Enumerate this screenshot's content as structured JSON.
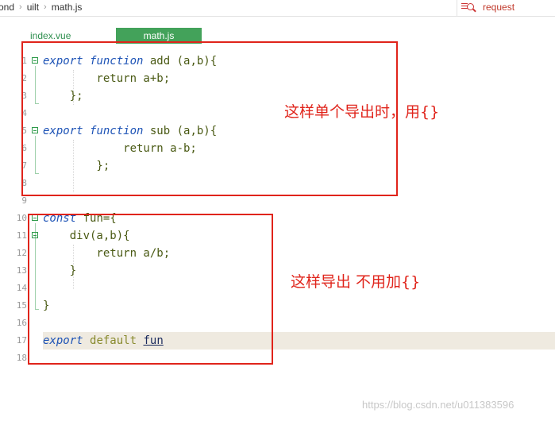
{
  "breadcrumb": [
    "ond",
    "uilt",
    "math.js"
  ],
  "search": {
    "query": "request"
  },
  "tabs": [
    {
      "label": "index.vue",
      "active": false
    },
    {
      "label": "math.js",
      "active": true
    }
  ],
  "code_lines": [
    {
      "num": "1",
      "parts": [
        [
          "kw",
          "export"
        ],
        [
          "sp",
          " "
        ],
        [
          "kw",
          "function"
        ],
        [
          "txt",
          " add (a,b){"
        ]
      ]
    },
    {
      "num": "2",
      "parts": [
        [
          "txt",
          "        return a+b;"
        ]
      ]
    },
    {
      "num": "3",
      "parts": [
        [
          "txt",
          "    };"
        ]
      ]
    },
    {
      "num": "4",
      "parts": []
    },
    {
      "num": "5",
      "parts": [
        [
          "kw",
          "export"
        ],
        [
          "sp",
          " "
        ],
        [
          "kw",
          "function"
        ],
        [
          "txt",
          " sub (a,b){"
        ]
      ]
    },
    {
      "num": "6",
      "parts": [
        [
          "txt",
          "            return a-b;"
        ]
      ]
    },
    {
      "num": "7",
      "parts": [
        [
          "txt",
          "        };"
        ]
      ]
    },
    {
      "num": "8",
      "parts": []
    },
    {
      "num": "9",
      "parts": []
    },
    {
      "num": "10",
      "parts": [
        [
          "kw",
          "const"
        ],
        [
          "txt",
          " fun={"
        ]
      ]
    },
    {
      "num": "11",
      "parts": [
        [
          "txt",
          "    div(a,b){"
        ]
      ]
    },
    {
      "num": "12",
      "parts": [
        [
          "txt",
          "        return a/b;"
        ]
      ]
    },
    {
      "num": "13",
      "parts": [
        [
          "txt",
          "    }"
        ]
      ]
    },
    {
      "num": "14",
      "parts": []
    },
    {
      "num": "15",
      "parts": [
        [
          "txt",
          "}"
        ]
      ]
    },
    {
      "num": "16",
      "parts": []
    },
    {
      "num": "17",
      "parts": [
        [
          "kw",
          "export"
        ],
        [
          "sp",
          " "
        ],
        [
          "kw2",
          "default"
        ],
        [
          "sp",
          " "
        ],
        [
          "fn",
          "fun"
        ]
      ],
      "highlight": true
    },
    {
      "num": "18",
      "parts": []
    }
  ],
  "annotations": {
    "note1": "这样单个导出时，用{}",
    "note2": "这样导出 不用加{}"
  },
  "watermark": "https://blog.csdn.net/u011383596",
  "colors": {
    "annotation": "#e0241b",
    "active_tab": "#43a25a",
    "keyword": "#1d53b6"
  }
}
